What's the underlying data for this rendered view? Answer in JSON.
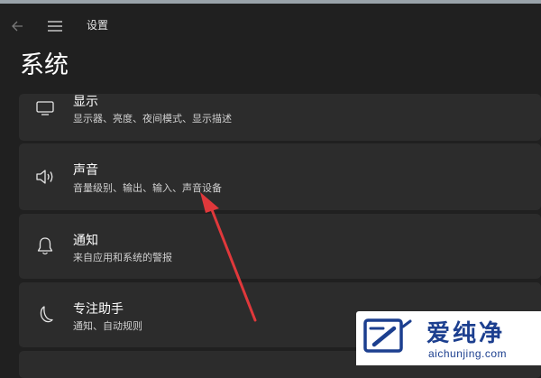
{
  "window": {
    "app_title": "设置",
    "back_icon": "back-arrow-icon",
    "menu_icon": "hamburger-menu-icon"
  },
  "page": {
    "title": "系统"
  },
  "settings_items": [
    {
      "label": "显示",
      "description": "显示器、亮度、夜间模式、显示描述",
      "icon": "monitor-icon"
    },
    {
      "label": "声音",
      "description": "音量级别、输出、输入、声音设备",
      "icon": "speaker-icon"
    },
    {
      "label": "通知",
      "description": "来自应用和系统的警报",
      "icon": "bell-icon"
    },
    {
      "label": "专注助手",
      "description": "通知、自动规则",
      "icon": "moon-icon"
    }
  ],
  "annotation": {
    "color": "#e0383b"
  },
  "watermark": {
    "title": "爱纯净",
    "url": "aichunjing.com",
    "color": "#1c3f8f"
  }
}
